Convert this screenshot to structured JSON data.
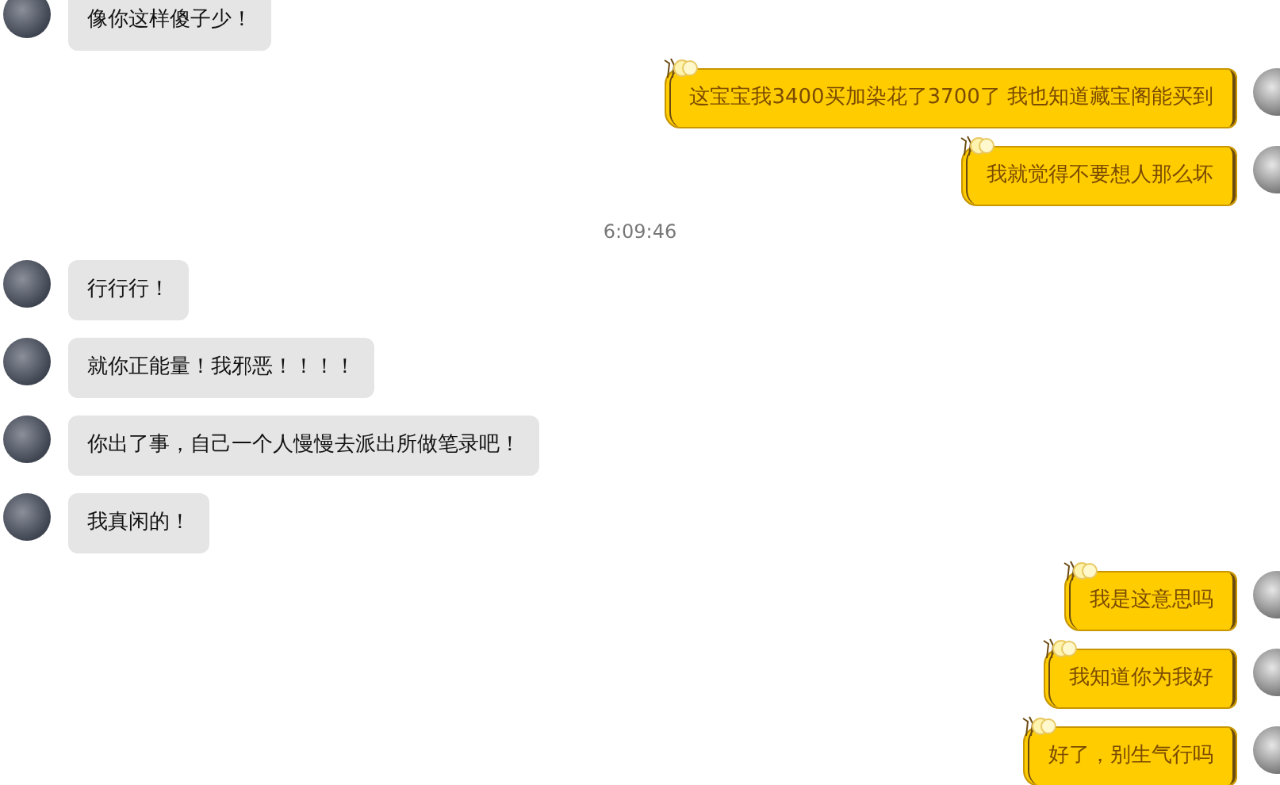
{
  "messages": [
    {
      "kind": "received",
      "text": "像你这样傻子少！"
    },
    {
      "kind": "sent",
      "text": "这宝宝我3400买加染花了3700了  我也知道藏宝阁能买到"
    },
    {
      "kind": "sent",
      "text": "我就觉得不要想人那么坏"
    },
    {
      "kind": "time",
      "text": "6:09:46"
    },
    {
      "kind": "received",
      "text": "行行行！"
    },
    {
      "kind": "received",
      "text": "就你正能量！我邪恶！！！！"
    },
    {
      "kind": "received",
      "text": "你出了事，自己一个人慢慢去派出所做笔录吧！"
    },
    {
      "kind": "received",
      "text": "我真闲的！"
    },
    {
      "kind": "sent",
      "text": "我是这意思吗"
    },
    {
      "kind": "sent",
      "text": "我知道你为我好"
    },
    {
      "kind": "sent",
      "text": "好了，别生气行吗"
    }
  ]
}
